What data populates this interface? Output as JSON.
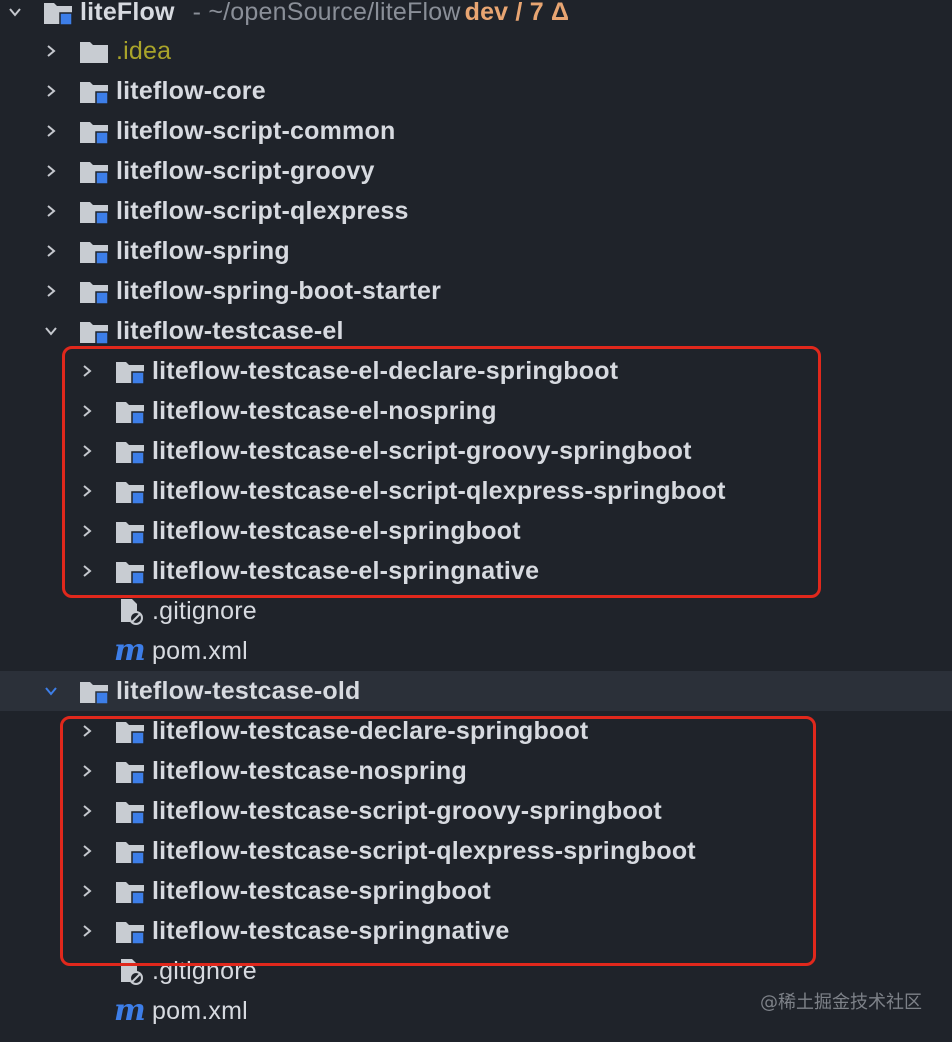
{
  "root": {
    "name": "liteFlow",
    "path": "- ~/openSource/liteFlow",
    "branch": "dev / 7 Δ"
  },
  "items": [
    {
      "label": "liteFlow-core"
    },
    {
      "label": ".idea"
    },
    {
      "label": "liteflow-core"
    },
    {
      "label": "liteflow-script-common"
    },
    {
      "label": "liteflow-script-groovy"
    },
    {
      "label": "liteflow-script-qlexpress"
    },
    {
      "label": "liteflow-spring"
    },
    {
      "label": "liteflow-spring-boot-starter"
    },
    {
      "label": "liteflow-testcase-el"
    },
    {
      "label": "liteflow-testcase-el-declare-springboot"
    },
    {
      "label": "liteflow-testcase-el-nospring"
    },
    {
      "label": "liteflow-testcase-el-script-groovy-springboot"
    },
    {
      "label": "liteflow-testcase-el-script-qlexpress-springboot"
    },
    {
      "label": "liteflow-testcase-el-springboot"
    },
    {
      "label": "liteflow-testcase-el-springnative"
    },
    {
      "label": ".gitignore"
    },
    {
      "label": "pom.xml"
    },
    {
      "label": "liteflow-testcase-old"
    },
    {
      "label": "liteflow-testcase-declare-springboot"
    },
    {
      "label": "liteflow-testcase-nospring"
    },
    {
      "label": "liteflow-testcase-script-groovy-springboot"
    },
    {
      "label": "liteflow-testcase-script-qlexpress-springboot"
    },
    {
      "label": "liteflow-testcase-springboot"
    },
    {
      "label": "liteflow-testcase-springnative"
    },
    {
      "label": ".gitignore"
    },
    {
      "label": "pom.xml"
    }
  ],
  "maven_glyph": "m",
  "watermark": "@稀土掘金技术社区",
  "colors": {
    "background": "#1f232a",
    "text": "#d7dae0",
    "idea_folder_text": "#a9a42a",
    "branch": "#e8a572",
    "module_badge": "#3d7ee8",
    "highlight_border": "#e0281c",
    "selected_row": "#2b3039"
  },
  "icons": {
    "collapsed": "chevron-right-icon",
    "expanded": "chevron-down-icon",
    "module": "module-folder-icon",
    "folder": "folder-icon",
    "gitignore": "gitignore-file-icon",
    "maven": "maven-file-icon"
  }
}
